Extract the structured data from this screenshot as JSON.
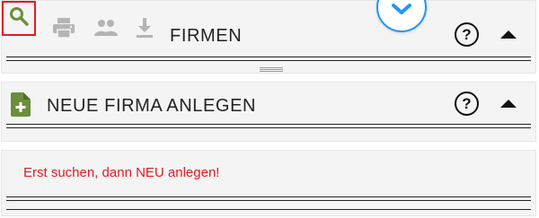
{
  "firmen_panel": {
    "title": "FIRMEN",
    "help_label": "?",
    "toolbar_icons": [
      "search-icon",
      "print-icon",
      "people-icon",
      "download-icon"
    ]
  },
  "new_company_panel": {
    "title": "NEUE FIRMA ANLEGEN",
    "help_label": "?",
    "icon": "file-plus-icon"
  },
  "message_panel": {
    "text": "Erst suchen, dann NEU anlegen!"
  },
  "colors": {
    "error_red": "#e01b24",
    "icon_green": "#6a8f3a",
    "disabled_gray": "#b4b4b4",
    "fab_blue": "#2196f3",
    "panel_bg": "#f4f4f4"
  }
}
